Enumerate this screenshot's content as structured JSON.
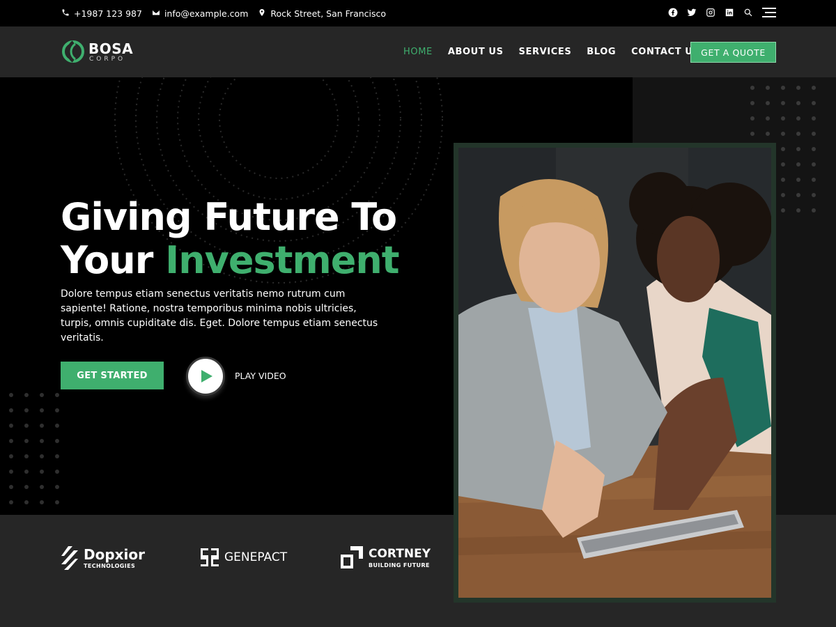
{
  "topbar": {
    "phone": "+1987 123 987",
    "email": "info@example.com",
    "address": "Rock Street, San Francisco",
    "icons": [
      "phone-icon",
      "mail-icon",
      "location-pin-icon",
      "facebook-icon",
      "twitter-icon",
      "instagram-icon",
      "linkedin-icon",
      "search-icon",
      "menu-icon"
    ]
  },
  "header": {
    "logo_name": "BOSA",
    "logo_sub": "CORPO",
    "nav": [
      {
        "label": "HOME",
        "active": true
      },
      {
        "label": "ABOUT US",
        "active": false
      },
      {
        "label": "SERVICES",
        "active": false
      },
      {
        "label": "BLOG",
        "active": false
      },
      {
        "label": "CONTACT US",
        "active": false
      }
    ],
    "cta_label": "GET A QUOTE"
  },
  "hero": {
    "title_line1": "Giving Future To",
    "title_line2_prefix": "Your ",
    "title_line2_accent": "Investment",
    "text": "Dolore tempus etiam senectus veritatis nemo rutrum cum sapiente! Ratione, nostra temporibus minima nobis ultricies, turpis, omnis cupiditate dis. Eget. Dolore tempus etiam senectus veritatis.",
    "start_label": "GET STARTED",
    "play_label": "PLAY VIDEO"
  },
  "brands": [
    {
      "name": "Dopxior",
      "tag": "TECHNOLOGIES"
    },
    {
      "name": "GENEPACT",
      "tag": ""
    },
    {
      "name": "CORTNEY",
      "tag": "BUILDING FUTURE"
    }
  ],
  "colors": {
    "accent": "#3faf6e",
    "header_bg": "#262626",
    "hero_bg": "#000000"
  }
}
